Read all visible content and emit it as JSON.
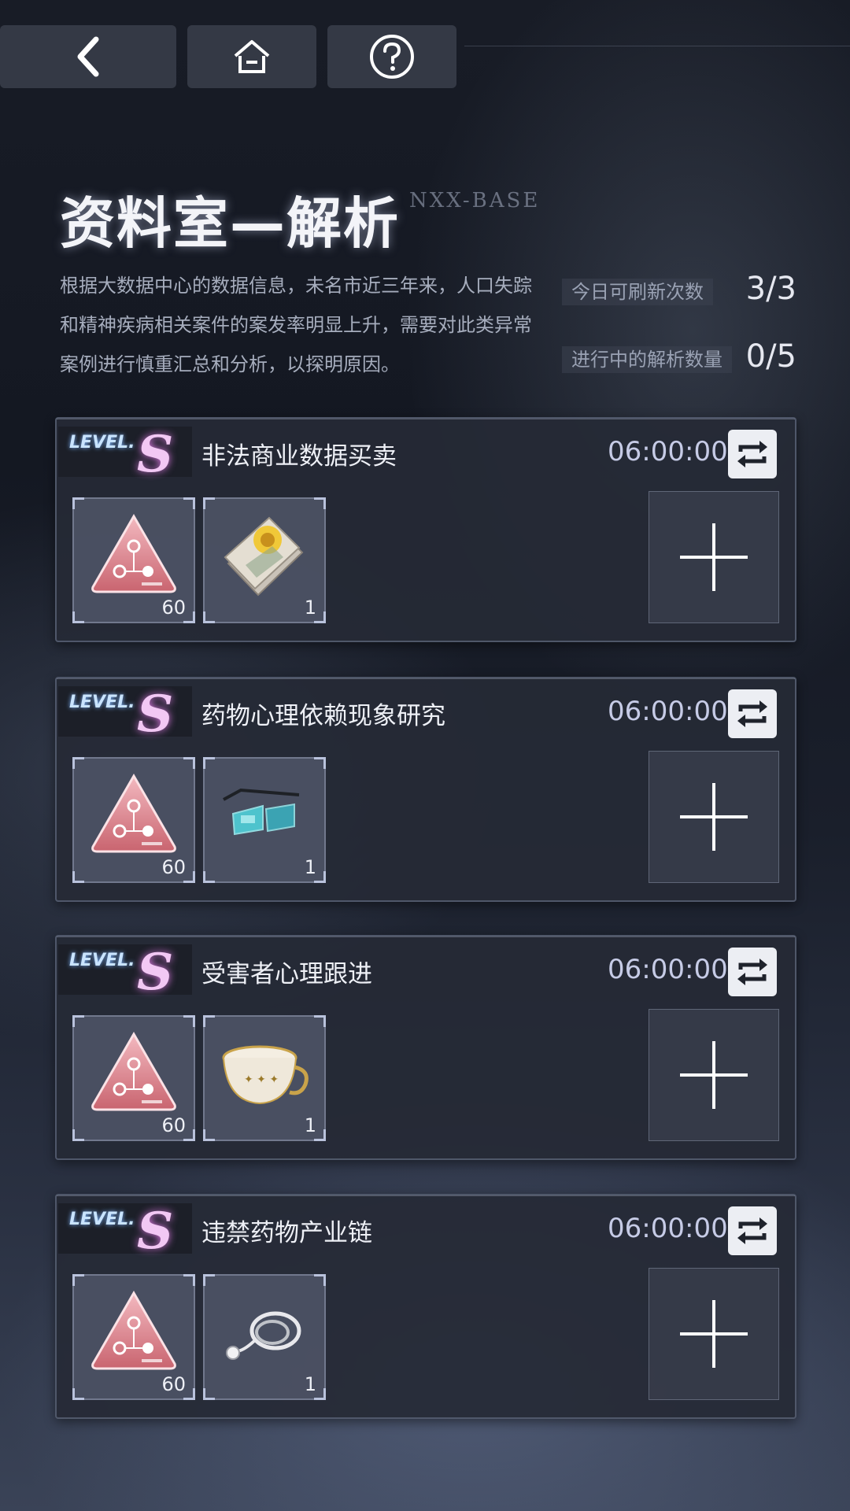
{
  "nav": {
    "back_icon": "chevron-left-icon",
    "home_icon": "home-icon",
    "help_icon": "question-circle-icon"
  },
  "header": {
    "title": "资料室—解析",
    "subtitle": "NXX-BASE",
    "description": "根据大数据中心的数据信息，未名市近三年来，人口失踪和精神疾病相关案件的案发率明显上升，需要对此类异常案例进行慎重汇总和分析，以探明原因。"
  },
  "stats": {
    "refresh_label": "今日可刷新次数",
    "refresh_value": "3/3",
    "active_label": "进行中的解析数量",
    "active_value": "0/5"
  },
  "cases": [
    {
      "level_text": "LEVEL.",
      "level": "S",
      "title": "非法商业数据买卖",
      "time": "06:00:00",
      "items": [
        {
          "icon": "triangle-crystal-icon",
          "qty": "60"
        },
        {
          "icon": "notebook-icon",
          "qty": "1"
        }
      ]
    },
    {
      "level_text": "LEVEL.",
      "level": "S",
      "title": "药物心理依赖现象研究",
      "time": "06:00:00",
      "items": [
        {
          "icon": "triangle-crystal-icon",
          "qty": "60"
        },
        {
          "icon": "smart-glasses-icon",
          "qty": "1"
        }
      ]
    },
    {
      "level_text": "LEVEL.",
      "level": "S",
      "title": "受害者心理跟进",
      "time": "06:00:00",
      "items": [
        {
          "icon": "triangle-crystal-icon",
          "qty": "60"
        },
        {
          "icon": "teacup-icon",
          "qty": "1"
        }
      ]
    },
    {
      "level_text": "LEVEL.",
      "level": "S",
      "title": "违禁药物产业链",
      "time": "06:00:00",
      "items": [
        {
          "icon": "triangle-crystal-icon",
          "qty": "60"
        },
        {
          "icon": "stethoscope-icon",
          "qty": "1"
        }
      ]
    }
  ],
  "colors": {
    "accent_level": "#e07ce6",
    "level_text": "#c9e4ff",
    "time": "#c6cbe6"
  }
}
